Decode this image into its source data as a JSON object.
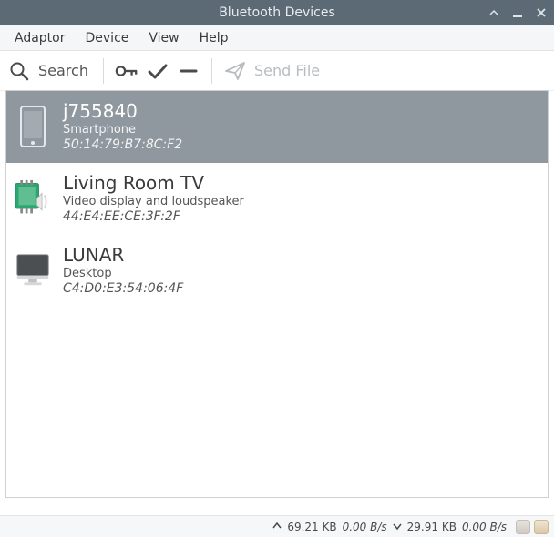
{
  "window": {
    "title": "Bluetooth Devices"
  },
  "menubar": {
    "items": [
      "Adaptor",
      "Device",
      "View",
      "Help"
    ]
  },
  "toolbar": {
    "search_label": "Search",
    "send_file_label": "Send File"
  },
  "devices": [
    {
      "name": "j755840",
      "type": "Smartphone",
      "mac": "50:14:79:B7:8C:F2",
      "selected": true,
      "icon": "phone"
    },
    {
      "name": "Living Room TV",
      "type": "Video display and loudspeaker",
      "mac": "44:E4:EE:CE:3F:2F",
      "selected": false,
      "icon": "tv-speaker"
    },
    {
      "name": "LUNAR",
      "type": "Desktop",
      "mac": "C4:D0:E3:54:06:4F",
      "selected": false,
      "icon": "desktop"
    }
  ],
  "statusbar": {
    "up_total": "69.21 KB",
    "up_rate": "0.00 B/s",
    "down_total": "29.91 KB",
    "down_rate": "0.00 B/s"
  }
}
